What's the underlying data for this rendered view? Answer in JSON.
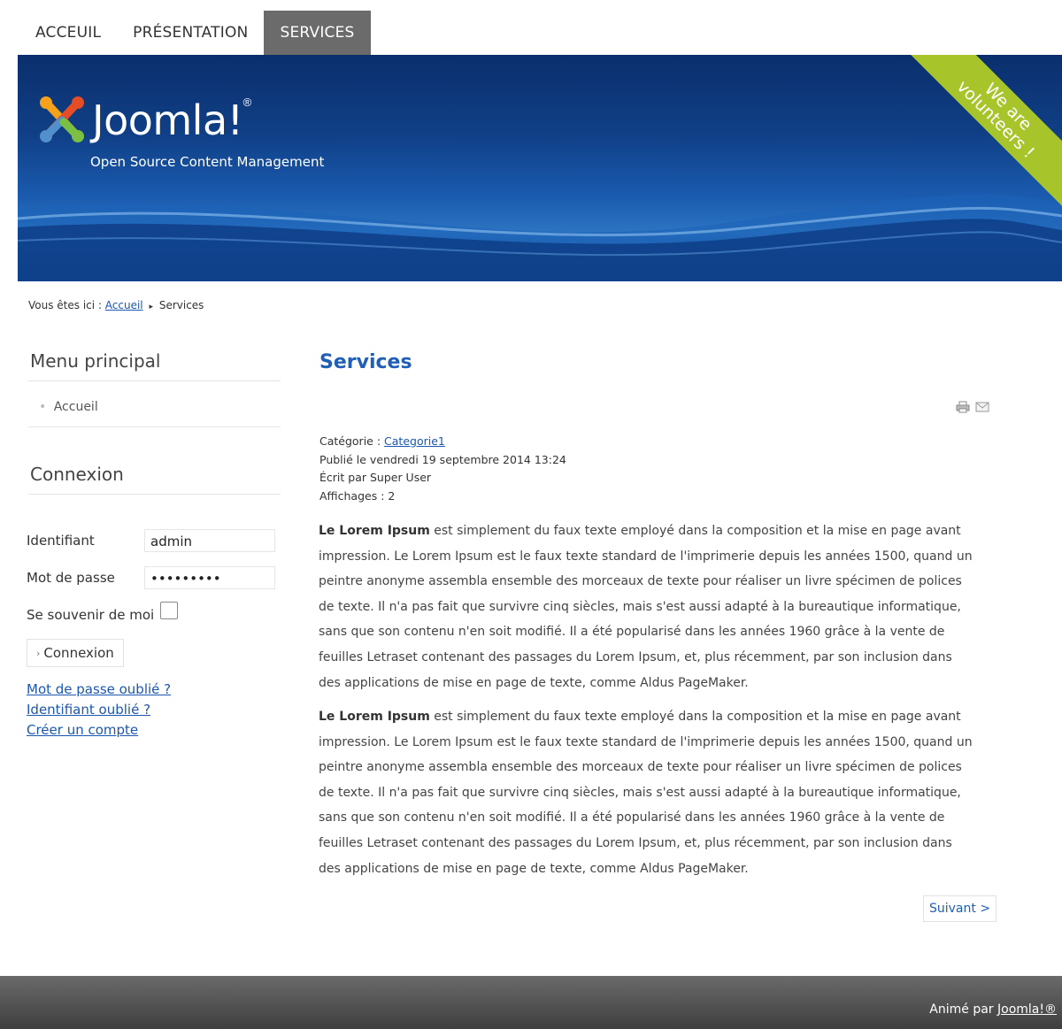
{
  "nav": {
    "tabs": [
      {
        "label": "ACCEUIL"
      },
      {
        "label": "PRÉSENTATION"
      },
      {
        "label": "SERVICES"
      }
    ],
    "active_index": 2
  },
  "banner": {
    "logo_text": "Joomla!",
    "logo_reg": "®",
    "tagline": "Open Source Content Management",
    "ribbon_line1": "We are",
    "ribbon_line2": "volunteers !"
  },
  "breadcrumb": {
    "prefix": "Vous êtes ici :",
    "home": "Accueil",
    "separator": "▸",
    "current": "Services"
  },
  "sidebar": {
    "menu_title": "Menu principal",
    "menu_items": [
      {
        "label": "Accueil"
      }
    ],
    "login_title": "Connexion",
    "username_label": "Identifiant",
    "username_value": "admin",
    "password_label": "Mot de passe",
    "password_value": "•••••••••",
    "remember_label": "Se souvenir de moi",
    "remember_checked": false,
    "login_button": "Connexion",
    "links": [
      {
        "label": "Mot de passe oublié ?"
      },
      {
        "label": "Identifiant oublié ?"
      },
      {
        "label": "Créer un compte"
      }
    ]
  },
  "article": {
    "title": "Services",
    "category_label": "Catégorie :",
    "category_link": "Categorie1",
    "published": "Publié le vendredi 19 septembre 2014 13:24",
    "author": "Écrit par Super User",
    "hits": "Affichages : 2",
    "paragraphs": [
      {
        "lead": "Le Lorem Ipsum",
        "text": " est simplement du faux texte employé dans la composition et la mise en page avant impression. Le Lorem Ipsum est le faux texte standard de l'imprimerie depuis les années 1500, quand un peintre anonyme assembla ensemble des morceaux de texte pour réaliser un livre spécimen de polices de texte. Il n'a pas fait que survivre cinq siècles, mais s'est aussi adapté à la bureautique informatique, sans que son contenu n'en soit modifié. Il a été popularisé dans les années 1960 grâce à la vente de feuilles Letraset contenant des passages du Lorem Ipsum, et, plus récemment, par son inclusion dans des applications de mise en page de texte, comme Aldus PageMaker."
      },
      {
        "lead": "Le Lorem Ipsum",
        "text": " est simplement du faux texte employé dans la composition et la mise en page avant impression. Le Lorem Ipsum est le faux texte standard de l'imprimerie depuis les années 1500, quand un peintre anonyme assembla ensemble des morceaux de texte pour réaliser un livre spécimen de polices de texte. Il n'a pas fait que survivre cinq siècles, mais s'est aussi adapté à la bureautique informatique, sans que son contenu n'en soit modifié. Il a été popularisé dans les années 1960 grâce à la vente de feuilles Letraset contenant des passages du Lorem Ipsum, et, plus récemment, par son inclusion dans des applications de mise en page de texte, comme Aldus PageMaker."
      }
    ],
    "next_button": "Suivant >"
  },
  "icons": {
    "print": "print-icon",
    "email": "email-icon"
  },
  "footer": {
    "prefix": "Animé par",
    "link": "Joomla!®"
  },
  "colors": {
    "link": "#1b57b1",
    "title": "#1f5fb8",
    "nav_active": "#6b6b6b",
    "ribbon": "#a7c52b",
    "banner": "#103f86"
  }
}
